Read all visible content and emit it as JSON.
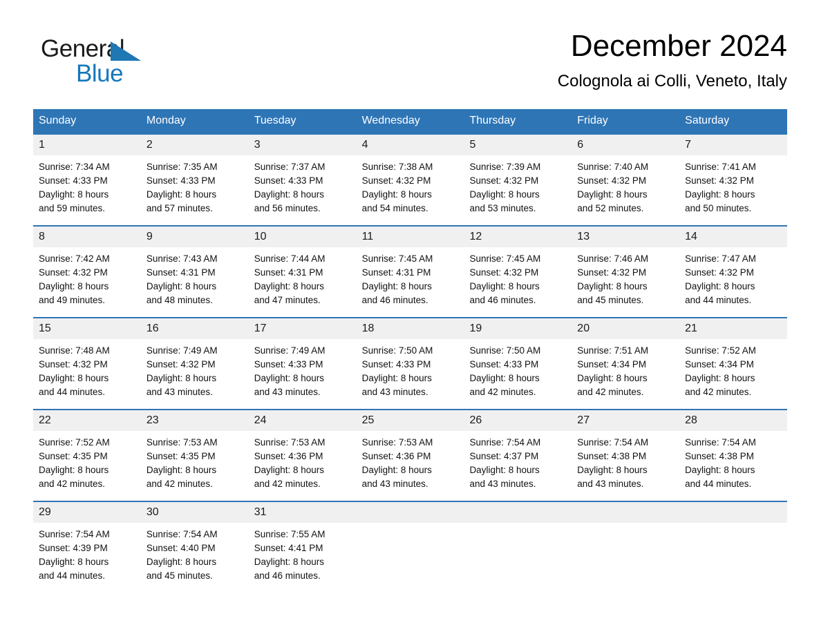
{
  "brand": {
    "line1": "General",
    "line2": "Blue",
    "triangle_color": "#1f77b4",
    "line2_color": "#1577bd"
  },
  "header": {
    "title": "December 2024",
    "subtitle": "Colognola ai Colli, Veneto, Italy"
  },
  "theme": {
    "header_blue": "#2e75b6",
    "daynum_band": "#f0f0f0",
    "text": "#111111"
  },
  "weekdays": [
    "Sunday",
    "Monday",
    "Tuesday",
    "Wednesday",
    "Thursday",
    "Friday",
    "Saturday"
  ],
  "weeks": [
    [
      {
        "day": "1",
        "sunrise": "Sunrise: 7:34 AM",
        "sunset": "Sunset: 4:33 PM",
        "daylight1": "Daylight: 8 hours",
        "daylight2": "and 59 minutes."
      },
      {
        "day": "2",
        "sunrise": "Sunrise: 7:35 AM",
        "sunset": "Sunset: 4:33 PM",
        "daylight1": "Daylight: 8 hours",
        "daylight2": "and 57 minutes."
      },
      {
        "day": "3",
        "sunrise": "Sunrise: 7:37 AM",
        "sunset": "Sunset: 4:33 PM",
        "daylight1": "Daylight: 8 hours",
        "daylight2": "and 56 minutes."
      },
      {
        "day": "4",
        "sunrise": "Sunrise: 7:38 AM",
        "sunset": "Sunset: 4:32 PM",
        "daylight1": "Daylight: 8 hours",
        "daylight2": "and 54 minutes."
      },
      {
        "day": "5",
        "sunrise": "Sunrise: 7:39 AM",
        "sunset": "Sunset: 4:32 PM",
        "daylight1": "Daylight: 8 hours",
        "daylight2": "and 53 minutes."
      },
      {
        "day": "6",
        "sunrise": "Sunrise: 7:40 AM",
        "sunset": "Sunset: 4:32 PM",
        "daylight1": "Daylight: 8 hours",
        "daylight2": "and 52 minutes."
      },
      {
        "day": "7",
        "sunrise": "Sunrise: 7:41 AM",
        "sunset": "Sunset: 4:32 PM",
        "daylight1": "Daylight: 8 hours",
        "daylight2": "and 50 minutes."
      }
    ],
    [
      {
        "day": "8",
        "sunrise": "Sunrise: 7:42 AM",
        "sunset": "Sunset: 4:32 PM",
        "daylight1": "Daylight: 8 hours",
        "daylight2": "and 49 minutes."
      },
      {
        "day": "9",
        "sunrise": "Sunrise: 7:43 AM",
        "sunset": "Sunset: 4:31 PM",
        "daylight1": "Daylight: 8 hours",
        "daylight2": "and 48 minutes."
      },
      {
        "day": "10",
        "sunrise": "Sunrise: 7:44 AM",
        "sunset": "Sunset: 4:31 PM",
        "daylight1": "Daylight: 8 hours",
        "daylight2": "and 47 minutes."
      },
      {
        "day": "11",
        "sunrise": "Sunrise: 7:45 AM",
        "sunset": "Sunset: 4:31 PM",
        "daylight1": "Daylight: 8 hours",
        "daylight2": "and 46 minutes."
      },
      {
        "day": "12",
        "sunrise": "Sunrise: 7:45 AM",
        "sunset": "Sunset: 4:32 PM",
        "daylight1": "Daylight: 8 hours",
        "daylight2": "and 46 minutes."
      },
      {
        "day": "13",
        "sunrise": "Sunrise: 7:46 AM",
        "sunset": "Sunset: 4:32 PM",
        "daylight1": "Daylight: 8 hours",
        "daylight2": "and 45 minutes."
      },
      {
        "day": "14",
        "sunrise": "Sunrise: 7:47 AM",
        "sunset": "Sunset: 4:32 PM",
        "daylight1": "Daylight: 8 hours",
        "daylight2": "and 44 minutes."
      }
    ],
    [
      {
        "day": "15",
        "sunrise": "Sunrise: 7:48 AM",
        "sunset": "Sunset: 4:32 PM",
        "daylight1": "Daylight: 8 hours",
        "daylight2": "and 44 minutes."
      },
      {
        "day": "16",
        "sunrise": "Sunrise: 7:49 AM",
        "sunset": "Sunset: 4:32 PM",
        "daylight1": "Daylight: 8 hours",
        "daylight2": "and 43 minutes."
      },
      {
        "day": "17",
        "sunrise": "Sunrise: 7:49 AM",
        "sunset": "Sunset: 4:33 PM",
        "daylight1": "Daylight: 8 hours",
        "daylight2": "and 43 minutes."
      },
      {
        "day": "18",
        "sunrise": "Sunrise: 7:50 AM",
        "sunset": "Sunset: 4:33 PM",
        "daylight1": "Daylight: 8 hours",
        "daylight2": "and 43 minutes."
      },
      {
        "day": "19",
        "sunrise": "Sunrise: 7:50 AM",
        "sunset": "Sunset: 4:33 PM",
        "daylight1": "Daylight: 8 hours",
        "daylight2": "and 42 minutes."
      },
      {
        "day": "20",
        "sunrise": "Sunrise: 7:51 AM",
        "sunset": "Sunset: 4:34 PM",
        "daylight1": "Daylight: 8 hours",
        "daylight2": "and 42 minutes."
      },
      {
        "day": "21",
        "sunrise": "Sunrise: 7:52 AM",
        "sunset": "Sunset: 4:34 PM",
        "daylight1": "Daylight: 8 hours",
        "daylight2": "and 42 minutes."
      }
    ],
    [
      {
        "day": "22",
        "sunrise": "Sunrise: 7:52 AM",
        "sunset": "Sunset: 4:35 PM",
        "daylight1": "Daylight: 8 hours",
        "daylight2": "and 42 minutes."
      },
      {
        "day": "23",
        "sunrise": "Sunrise: 7:53 AM",
        "sunset": "Sunset: 4:35 PM",
        "daylight1": "Daylight: 8 hours",
        "daylight2": "and 42 minutes."
      },
      {
        "day": "24",
        "sunrise": "Sunrise: 7:53 AM",
        "sunset": "Sunset: 4:36 PM",
        "daylight1": "Daylight: 8 hours",
        "daylight2": "and 42 minutes."
      },
      {
        "day": "25",
        "sunrise": "Sunrise: 7:53 AM",
        "sunset": "Sunset: 4:36 PM",
        "daylight1": "Daylight: 8 hours",
        "daylight2": "and 43 minutes."
      },
      {
        "day": "26",
        "sunrise": "Sunrise: 7:54 AM",
        "sunset": "Sunset: 4:37 PM",
        "daylight1": "Daylight: 8 hours",
        "daylight2": "and 43 minutes."
      },
      {
        "day": "27",
        "sunrise": "Sunrise: 7:54 AM",
        "sunset": "Sunset: 4:38 PM",
        "daylight1": "Daylight: 8 hours",
        "daylight2": "and 43 minutes."
      },
      {
        "day": "28",
        "sunrise": "Sunrise: 7:54 AM",
        "sunset": "Sunset: 4:38 PM",
        "daylight1": "Daylight: 8 hours",
        "daylight2": "and 44 minutes."
      }
    ],
    [
      {
        "day": "29",
        "sunrise": "Sunrise: 7:54 AM",
        "sunset": "Sunset: 4:39 PM",
        "daylight1": "Daylight: 8 hours",
        "daylight2": "and 44 minutes."
      },
      {
        "day": "30",
        "sunrise": "Sunrise: 7:54 AM",
        "sunset": "Sunset: 4:40 PM",
        "daylight1": "Daylight: 8 hours",
        "daylight2": "and 45 minutes."
      },
      {
        "day": "31",
        "sunrise": "Sunrise: 7:55 AM",
        "sunset": "Sunset: 4:41 PM",
        "daylight1": "Daylight: 8 hours",
        "daylight2": "and 46 minutes."
      },
      {
        "day": "",
        "sunrise": "",
        "sunset": "",
        "daylight1": "",
        "daylight2": ""
      },
      {
        "day": "",
        "sunrise": "",
        "sunset": "",
        "daylight1": "",
        "daylight2": ""
      },
      {
        "day": "",
        "sunrise": "",
        "sunset": "",
        "daylight1": "",
        "daylight2": ""
      },
      {
        "day": "",
        "sunrise": "",
        "sunset": "",
        "daylight1": "",
        "daylight2": ""
      }
    ]
  ]
}
